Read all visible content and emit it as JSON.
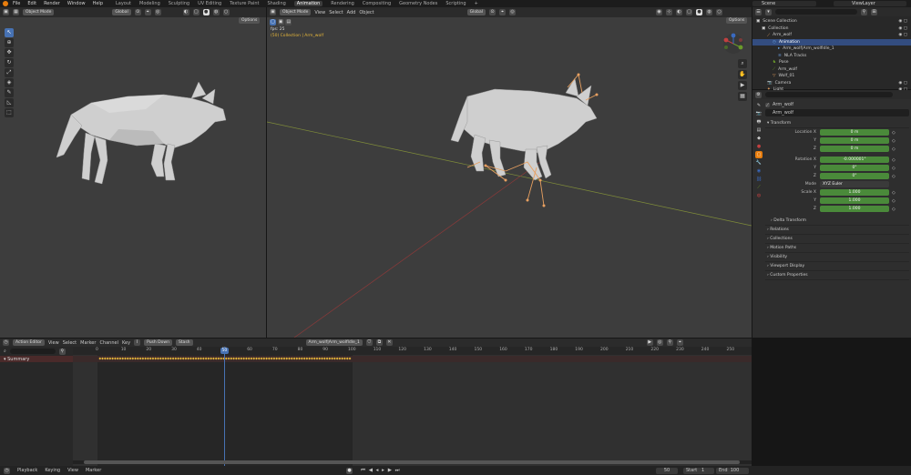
{
  "topbar": {
    "menus": [
      "File",
      "Edit",
      "Render",
      "Window",
      "Help"
    ],
    "workspaces": [
      "Layout",
      "Modeling",
      "Sculpting",
      "UV Editing",
      "Texture Paint",
      "Shading",
      "Animation",
      "Rendering",
      "Compositing",
      "Geometry Nodes",
      "Scripting"
    ],
    "active_workspace": "Animation",
    "add_tab": "+",
    "scene_label": "Scene",
    "viewlayer_label": "ViewLayer"
  },
  "left_viewport": {
    "mode": "Object Mode",
    "orientation": "Global",
    "options": "Options"
  },
  "main_viewport": {
    "mode": "Object Mode",
    "menus": [
      "View",
      "Select",
      "Add",
      "Object"
    ],
    "orientation": "Global",
    "options": "Options",
    "fps": "fps: 25",
    "collection": "(50) Collection | Arm_wolf"
  },
  "outliner": {
    "search_placeholder": "",
    "items": [
      {
        "label": "Scene Collection",
        "indent": 0,
        "icon": "collection-icon",
        "selected": false
      },
      {
        "label": "Collection",
        "indent": 1,
        "icon": "collection-icon",
        "selected": false
      },
      {
        "label": "Arm_wolf",
        "indent": 2,
        "icon": "armature-icon",
        "selected": false
      },
      {
        "label": "Animation",
        "indent": 3,
        "icon": "animation-icon",
        "selected": true
      },
      {
        "label": "Arm_wolf|Arm_wolfIdle_1",
        "indent": 4,
        "icon": "action-icon",
        "selected": false
      },
      {
        "label": "NLA Tracks",
        "indent": 4,
        "icon": "nla-icon",
        "selected": false
      },
      {
        "label": "Pose",
        "indent": 3,
        "icon": "pose-icon",
        "selected": false
      },
      {
        "label": "Arm_wolf",
        "indent": 3,
        "icon": "armature-data-icon",
        "selected": false
      },
      {
        "label": "Wolf_01",
        "indent": 3,
        "icon": "mesh-icon",
        "selected": false
      },
      {
        "label": "Camera",
        "indent": 2,
        "icon": "camera-icon",
        "selected": false
      },
      {
        "label": "Light",
        "indent": 2,
        "icon": "light-icon",
        "selected": false
      }
    ]
  },
  "properties": {
    "search_placeholder": "",
    "object_name_1": "Arm_wolf",
    "object_name_2": "Arm_wolf",
    "transform_title": "Transform",
    "location_label": "Location X",
    "location": [
      "0 m",
      "0 m",
      "0 m"
    ],
    "rotation_label": "Rotation X",
    "rotation": [
      "-0.000001°",
      "0°",
      "0°"
    ],
    "mode_label": "Mode",
    "mode_value": "XYZ Euler",
    "scale_label": "Scale X",
    "scale": [
      "1.000",
      "1.000",
      "1.000"
    ],
    "y_label": "Y",
    "z_label": "Z",
    "sections": [
      "Delta Transform",
      "Relations",
      "Collections",
      "Motion Paths",
      "Visibility",
      "Viewport Display",
      "Custom Properties"
    ]
  },
  "action_editor": {
    "mode": "Action Editor",
    "menus": [
      "View",
      "Select",
      "Marker",
      "Channel",
      "Key"
    ],
    "push_down": "Push Down",
    "stash": "Stash",
    "action_name": "Arm_wolf|Arm_wolfIdle_1",
    "summary": "Summary",
    "current_frame": "50",
    "ticks": [
      "0",
      "10",
      "20",
      "30",
      "40",
      "50",
      "60",
      "70",
      "80",
      "90",
      "100",
      "110",
      "120",
      "130",
      "140",
      "150",
      "160",
      "170",
      "180",
      "190",
      "200",
      "210",
      "220",
      "230",
      "240",
      "250"
    ]
  },
  "statusbar": {
    "menus": [
      "Playback",
      "Keying",
      "View",
      "Marker"
    ],
    "frame": "50",
    "start_label": "Start",
    "start": "1",
    "end_label": "End",
    "end": "100"
  },
  "colors": {
    "accent": "#4772b3",
    "keyframe": "#e8b83a",
    "green_field": "#4a8a3a",
    "orange": "#e87d0d"
  }
}
